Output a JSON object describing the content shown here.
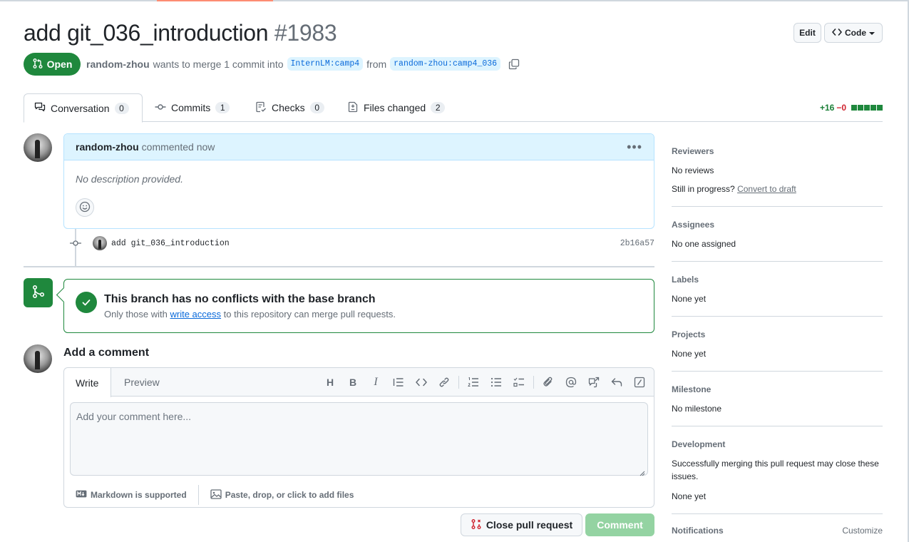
{
  "pr": {
    "title": "add git_036_introduction",
    "number": "#1983",
    "state": "Open",
    "author": "random-zhou",
    "merge_text": "wants to merge 1 commit into",
    "base_branch": "InternLM:camp4",
    "from_text": "from",
    "head_branch": "random-zhou:camp4_036"
  },
  "header": {
    "edit_label": "Edit",
    "code_label": "Code"
  },
  "tabs": [
    {
      "label": "Conversation",
      "count": "0"
    },
    {
      "label": "Commits",
      "count": "1"
    },
    {
      "label": "Checks",
      "count": "0"
    },
    {
      "label": "Files changed",
      "count": "2"
    }
  ],
  "diffstat": {
    "additions": "+16",
    "deletions": "−0"
  },
  "comment": {
    "author": "random-zhou",
    "action": "commented now",
    "body": "No description provided."
  },
  "commit": {
    "message": "add git_036_introduction",
    "sha": "2b16a57"
  },
  "merge": {
    "title": "This branch has no conflicts with the base branch",
    "sub_prefix": "Only those with",
    "sub_link": "write access",
    "sub_suffix": "to this repository can merge pull requests."
  },
  "add_comment": {
    "title": "Add a comment",
    "tab_write": "Write",
    "tab_preview": "Preview",
    "placeholder": "Add your comment here...",
    "markdown_note": "Markdown is supported",
    "attach_note": "Paste, drop, or click to add files",
    "close_button": "Close pull request",
    "comment_button": "Comment"
  },
  "sidebar": {
    "reviewers": {
      "title": "Reviewers",
      "value": "No reviews",
      "draft_prefix": "Still in progress?",
      "draft_link": "Convert to draft"
    },
    "assignees": {
      "title": "Assignees",
      "value": "No one assigned"
    },
    "labels": {
      "title": "Labels",
      "value": "None yet"
    },
    "projects": {
      "title": "Projects",
      "value": "None yet"
    },
    "milestone": {
      "title": "Milestone",
      "value": "No milestone"
    },
    "development": {
      "title": "Development",
      "note": "Successfully merging this pull request may close these issues.",
      "value": "None yet"
    },
    "notifications": {
      "title": "Notifications",
      "customize": "Customize"
    }
  },
  "colors": {
    "open_green": "#1f883d",
    "link_blue": "#0969da",
    "comment_header": "#ddf4ff",
    "accent_orange": "#fd8c73"
  }
}
